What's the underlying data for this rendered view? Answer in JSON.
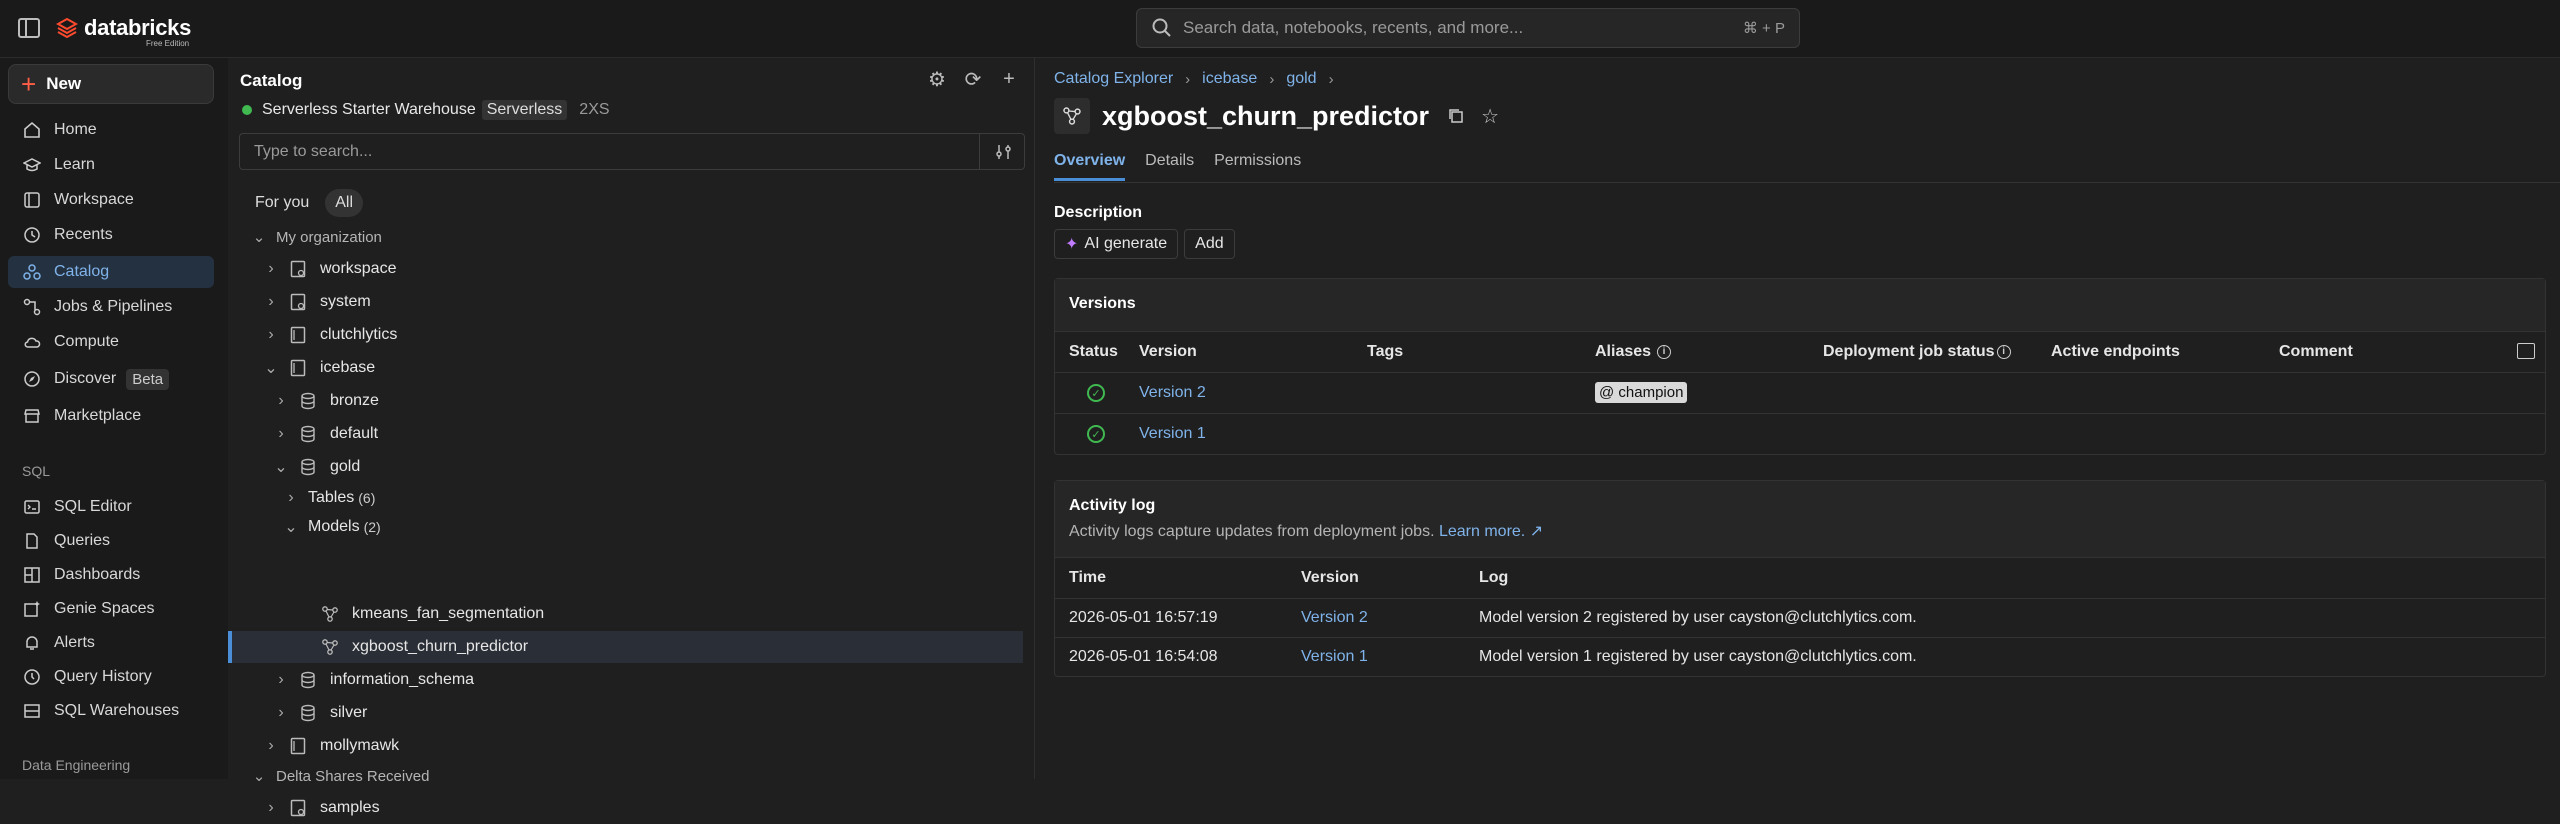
{
  "topbar": {
    "logo_text": "databricks",
    "logo_subtext": "Free Edition",
    "search_placeholder": "Search data, notebooks, recents, and more...",
    "search_shortcut": "⌘ + P"
  },
  "sidebar": {
    "new_label": "New",
    "items": [
      {
        "label": "Home",
        "icon": "home-icon"
      },
      {
        "label": "Learn",
        "icon": "learn-icon"
      },
      {
        "label": "Workspace",
        "icon": "workspace-icon"
      },
      {
        "label": "Recents",
        "icon": "clock-icon"
      },
      {
        "label": "Catalog",
        "icon": "catalog-icon",
        "active": true
      },
      {
        "label": "Jobs & Pipelines",
        "icon": "jobs-icon"
      },
      {
        "label": "Compute",
        "icon": "cloud-icon"
      },
      {
        "label": "Discover",
        "icon": "compass-icon",
        "badge": "Beta"
      },
      {
        "label": "Marketplace",
        "icon": "store-icon"
      }
    ],
    "sql_header": "SQL",
    "sql_items": [
      {
        "label": "SQL Editor",
        "icon": "sql-editor-icon"
      },
      {
        "label": "Queries",
        "icon": "queries-icon"
      },
      {
        "label": "Dashboards",
        "icon": "dashboards-icon"
      },
      {
        "label": "Genie Spaces",
        "icon": "genie-icon"
      },
      {
        "label": "Alerts",
        "icon": "bell-icon"
      },
      {
        "label": "Query History",
        "icon": "history-icon"
      },
      {
        "label": "SQL Warehouses",
        "icon": "warehouse-icon"
      }
    ],
    "de_header": "Data Engineering"
  },
  "catalog": {
    "title": "Catalog",
    "warehouse_name": "Serverless Starter Warehouse",
    "warehouse_tag": "Serverless",
    "warehouse_size": "2XS",
    "search_placeholder": "Type to search...",
    "pill_for_you": "For you",
    "pill_all": "All",
    "tree": [
      {
        "label": "My organization",
        "type": "group"
      },
      {
        "label": "workspace"
      },
      {
        "label": "system"
      },
      {
        "label": "clutchlytics"
      },
      {
        "label": "icebase"
      },
      {
        "label": "bronze"
      },
      {
        "label": "default"
      },
      {
        "label": "gold"
      },
      {
        "label": "Tables",
        "count": "(6)"
      },
      {
        "label": "Models",
        "count": "(2)"
      },
      {
        "label": "kmeans_fan_segmentation"
      },
      {
        "label": "xgboost_churn_predictor",
        "selected": true
      },
      {
        "label": "information_schema"
      },
      {
        "label": "silver"
      },
      {
        "label": "mollymawk"
      },
      {
        "label": "Delta Shares Received",
        "type": "group"
      },
      {
        "label": "samples"
      }
    ]
  },
  "main": {
    "breadcrumb": [
      "Catalog Explorer",
      "icebase",
      "gold"
    ],
    "model_name": "xgboost_churn_predictor",
    "tabs": [
      "Overview",
      "Details",
      "Permissions"
    ],
    "description_label": "Description",
    "ai_generate_label": "AI generate",
    "add_label": "Add",
    "versions": {
      "title": "Versions",
      "columns": [
        "Status",
        "Version",
        "Tags",
        "Aliases",
        "Deployment job status",
        "Active endpoints",
        "Comment"
      ],
      "rows": [
        {
          "version": "Version 2",
          "alias": "@ champion"
        },
        {
          "version": "Version 1",
          "alias": ""
        }
      ]
    },
    "activity": {
      "title": "Activity log",
      "subtitle": "Activity logs capture updates from deployment jobs.",
      "learn_more": "Learn more.",
      "columns": [
        "Time",
        "Version",
        "Log"
      ],
      "rows": [
        {
          "time": "2026-05-01 16:57:19",
          "version": "Version 2",
          "log": "Model version 2 registered by user cayston@clutchlytics.com."
        },
        {
          "time": "2026-05-01 16:54:08",
          "version": "Version 1",
          "log": "Model version 1 registered by user cayston@clutchlytics.com."
        }
      ]
    }
  }
}
